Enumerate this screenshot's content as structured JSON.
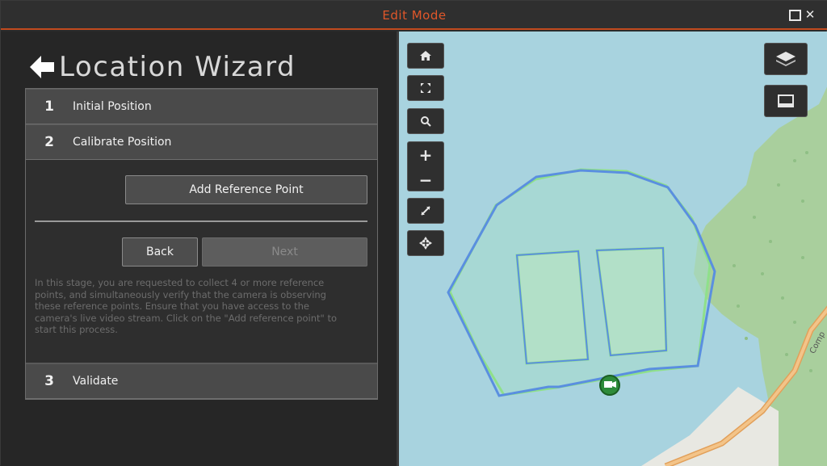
{
  "window": {
    "title": "Edit Mode",
    "maximize_icon": "maximize-icon",
    "close_icon": "close-icon",
    "close_glyph": "✕"
  },
  "wizard": {
    "title": "Location Wizard",
    "back_icon": "back-arrow-icon",
    "steps": [
      {
        "number": "1",
        "label": "Initial Position"
      },
      {
        "number": "2",
        "label": "Calibrate Position"
      },
      {
        "number": "3",
        "label": "Validate"
      }
    ],
    "add_reference_label": "Add Reference Point",
    "back_label": "Back",
    "next_label": "Next",
    "help_text": "In this stage, you are requested to collect 4 or more reference points, and simultaneously verify that the camera is observing these reference points. Ensure that you have access to the camera's live video stream. Click on the \"Add reference point\" to start this process."
  },
  "map": {
    "controls": [
      "home-icon",
      "fullscreen-icon",
      "search-icon",
      "zoom-in-icon",
      "zoom-out-icon",
      "measure-icon",
      "pan-icon"
    ],
    "zoom_in": "+",
    "zoom_out": "−",
    "layer_controls": [
      "layers-icon",
      "basemap-icon"
    ],
    "road_label": "Comp",
    "colors": {
      "water": "#a8d3df",
      "land": "#a9cf9d",
      "road": "#f0b46a",
      "polygon_blue": "#5a8fe0",
      "polygon_green": "#8fe08a",
      "camera": "#2e8b3a"
    }
  }
}
